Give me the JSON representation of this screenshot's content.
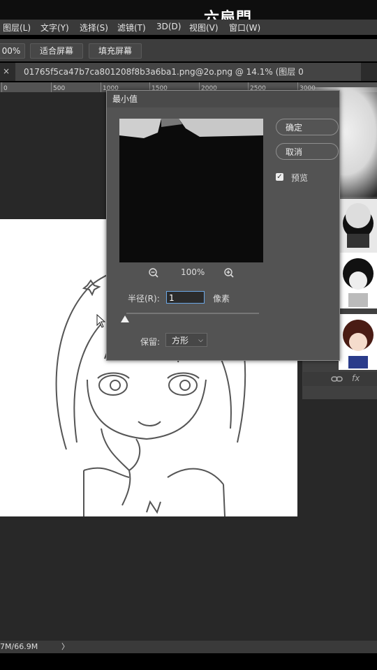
{
  "app": {
    "logo_text": "六扇門",
    "menu": [
      "图层(L)",
      "文字(Y)",
      "选择(S)",
      "滤镜(T)",
      "3D(D)",
      "视图(V)",
      "窗口(W)"
    ]
  },
  "options_bar": {
    "zoom_value": "00%",
    "fit_screen": "适合屏幕",
    "fill_screen": "填充屏幕"
  },
  "document_tab": {
    "close_glyph": "×",
    "title": "01765f5ca47b7ca801208f8b3a6ba1.png@2o.png @ 14.1% (图层 0"
  },
  "ruler": {
    "ticks": [
      "0",
      "500",
      "1000",
      "1500",
      "2000",
      "2500",
      "3000"
    ]
  },
  "dialog": {
    "title": "最小值",
    "ok": "确定",
    "cancel": "取消",
    "preview_label": "预览",
    "preview_checked": true,
    "zoom_percent": "100%",
    "radius_label": "半径(R):",
    "radius_value": "1",
    "unit": "像素",
    "radius_slider_fraction": 0.0,
    "preserve_label": "保留:",
    "preserve_value": "方形"
  },
  "panel": {
    "link_icon": "link-icon",
    "fx_label": "fx"
  },
  "status_bar": {
    "doc_size": "7M/66.9M",
    "arrow": "〉"
  }
}
